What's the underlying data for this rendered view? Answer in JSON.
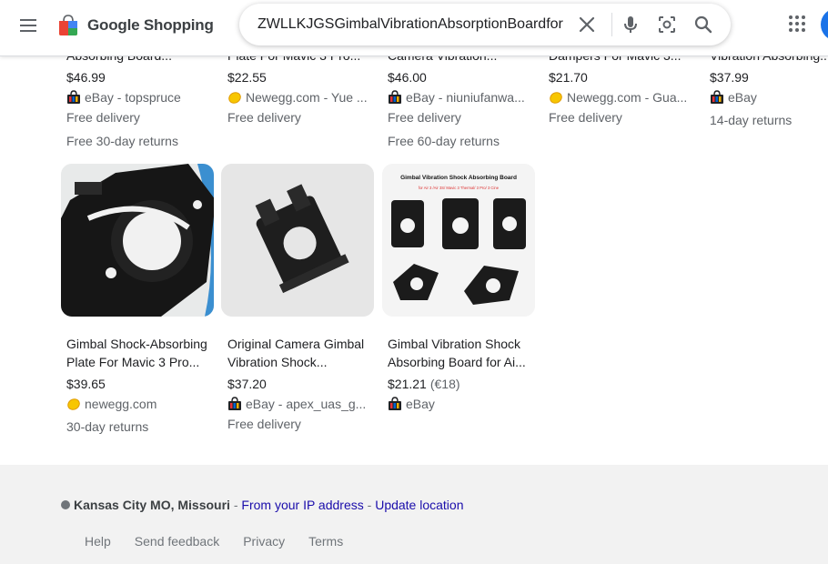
{
  "header": {
    "logo_text": "Google Shopping",
    "search_value": "ZWLLKJGSGimbalVibrationAbsorptionBoardfor",
    "icons": [
      "menu-icon",
      "clear-icon",
      "microphone-icon",
      "camera-lens-icon",
      "search-icon",
      "apps-grid-icon"
    ]
  },
  "top_row": [
    {
      "title_partial": "Absorbing Board...",
      "price": "$46.99",
      "merchant": "eBay - topspruce",
      "merchant_icon": "ebay-bag-icon",
      "line1": "Free delivery",
      "line2": "Free 30-day returns"
    },
    {
      "title_partial": "Plate For Mavic 3 Pro...",
      "price": "$22.55",
      "merchant": "Newegg.com - Yue ...",
      "merchant_icon": "newegg-egg-icon",
      "line1": "Free delivery",
      "line2": ""
    },
    {
      "title_partial": "Camera Vibration...",
      "price": "$46.00",
      "merchant": "eBay - niuniufanwa...",
      "merchant_icon": "ebay-bag-icon",
      "line1": "Free delivery",
      "line2": "Free 60-day returns"
    },
    {
      "title_partial": "Dampers For Mavic 3...",
      "price": "$21.70",
      "merchant": "Newegg.com - Gua...",
      "merchant_icon": "newegg-egg-icon",
      "line1": "Free delivery",
      "line2": ""
    },
    {
      "title_partial": "Vibration Absorbing...",
      "price": "$37.99",
      "merchant": "eBay",
      "merchant_icon": "ebay-bag-icon",
      "line1": "14-day returns",
      "line2": ""
    }
  ],
  "bottom_row": [
    {
      "title": "Gimbal Shock-Absorbing Plate For Mavic 3 Pro...",
      "title_l1": "Gimbal Shock-Absorbing",
      "title_l2": "Plate For Mavic 3 Pro...",
      "price": "$39.65",
      "price_alt": "",
      "merchant": "newegg.com",
      "merchant_icon": "newegg-egg-icon",
      "line1": "30-day returns"
    },
    {
      "title": "Original Camera Gimbal Vibration Shock...",
      "title_l1": "Original Camera Gimbal",
      "title_l2": "Vibration Shock...",
      "price": "$37.20",
      "price_alt": "",
      "merchant": "eBay - apex_uas_g...",
      "merchant_icon": "ebay-bag-icon",
      "line1": "Free delivery"
    },
    {
      "title": "Gimbal Vibration Shock Absorbing Board for Ai...",
      "title_l1": "Gimbal Vibration Shock",
      "title_l2": "Absorbing Board for Ai...",
      "price": "$21.21",
      "price_alt": "(€18)",
      "merchant": "eBay",
      "merchant_icon": "ebay-bag-icon",
      "line1": "",
      "image_caption": "Gimbal Vibration Shock Absorbing Board",
      "image_subcaption": "for Air 3 /Air 3S/ Mavic 3 Thermal/ 3 Pro/ 3 Cine"
    }
  ],
  "footer": {
    "location_city": "Kansas City MO, Missouri",
    "separator": " - ",
    "from_ip": "From your IP address",
    "update_location": "Update location",
    "links": [
      "Help",
      "Send feedback",
      "Privacy",
      "Terms"
    ]
  },
  "colors": {
    "link": "#1a0dab",
    "footer_bg": "#f2f2f2",
    "text_secondary": "#5f6368",
    "avatar": "#1a73e8"
  }
}
